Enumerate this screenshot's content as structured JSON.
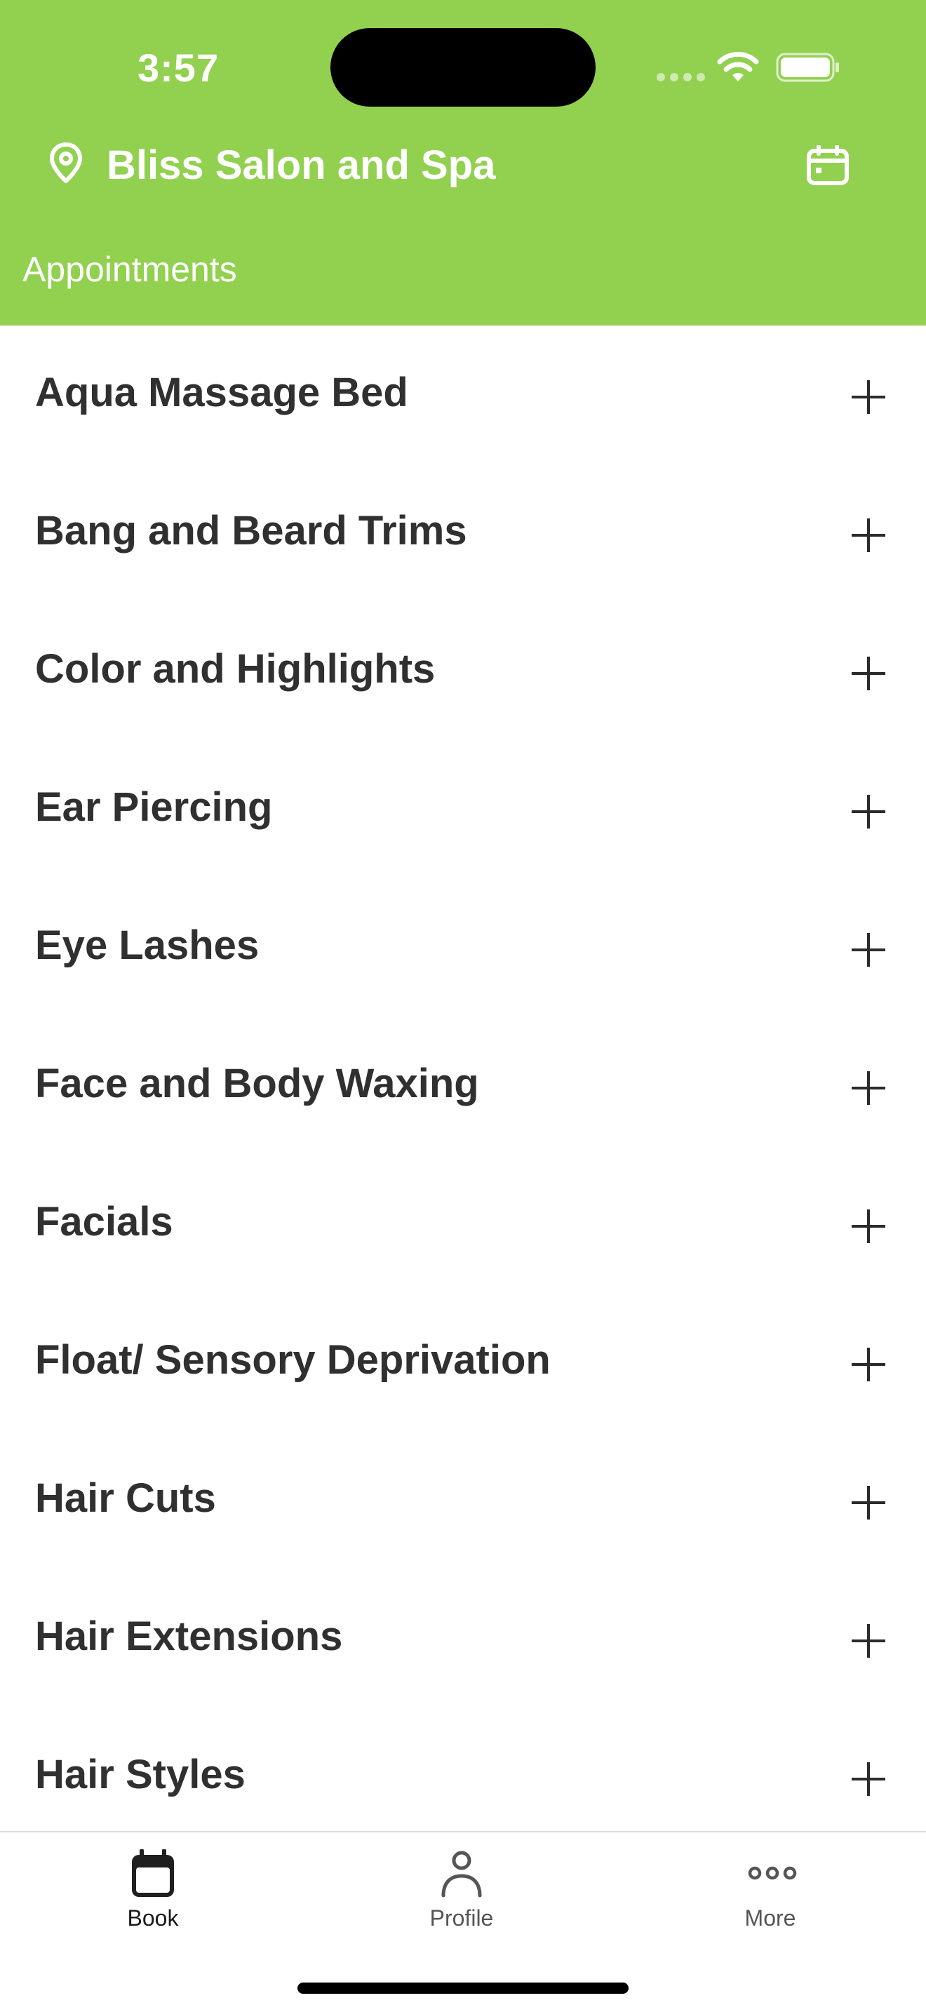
{
  "status_bar": {
    "time": "3:57",
    "icons": [
      "cellular-signal-icon",
      "wifi-icon",
      "battery-icon"
    ]
  },
  "header": {
    "location_icon": "location-pin-icon",
    "salon_name": "Bliss Salon and Spa",
    "calendar_icon": "calendar-icon",
    "section_label": "Appointments"
  },
  "services": [
    {
      "label": "Aqua Massage Bed"
    },
    {
      "label": "Bang and Beard Trims"
    },
    {
      "label": "Color and Highlights"
    },
    {
      "label": "Ear Piercing"
    },
    {
      "label": "Eye Lashes"
    },
    {
      "label": "Face and Body Waxing"
    },
    {
      "label": "Facials"
    },
    {
      "label": "Float/ Sensory Deprivation"
    },
    {
      "label": "Hair Cuts"
    },
    {
      "label": "Hair Extensions"
    },
    {
      "label": "Hair Styles"
    }
  ],
  "tabbar": {
    "tabs": [
      {
        "label": "Book",
        "icon": "calendar-icon",
        "active": true
      },
      {
        "label": "Profile",
        "icon": "person-icon",
        "active": false
      },
      {
        "label": "More",
        "icon": "more-dots-icon",
        "active": false
      }
    ]
  },
  "colors": {
    "header_background": "#92d050",
    "text_primary": "#303030",
    "header_text": "#ffffff"
  }
}
